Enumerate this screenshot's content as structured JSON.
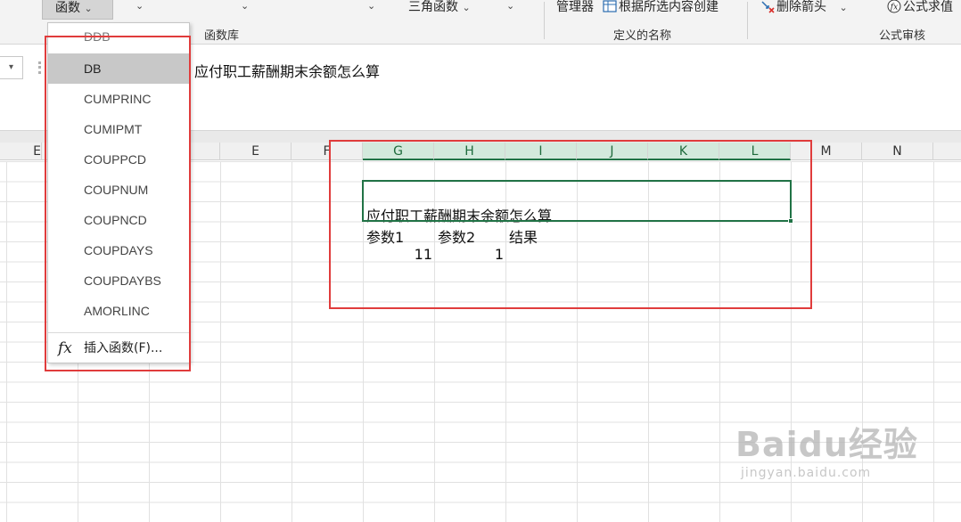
{
  "ribbon": {
    "function_button": "函数",
    "trig_button": "三角函数",
    "name_manager": "管理器",
    "create_from_selection": "根据所选内容创建",
    "remove_arrows": "删除箭头",
    "evaluate_formula": "公式求值",
    "groups": {
      "function_library": "函数库",
      "defined_names": "定义的名称",
      "formula_auditing": "公式审核"
    }
  },
  "formula_bar": {
    "content": "应付职工薪酬期末余额怎么算"
  },
  "columns": [
    "E",
    "F",
    "G",
    "H",
    "I",
    "J",
    "K",
    "L",
    "M",
    "N"
  ],
  "partial_column": "E",
  "selected_columns": [
    "G",
    "H",
    "I",
    "J",
    "K",
    "L"
  ],
  "sheet": {
    "title_cell": "应付职工薪酬期末余额怎么算",
    "headers": [
      "参数1",
      "参数2",
      "结果"
    ],
    "values": [
      "11",
      "1"
    ]
  },
  "menu": {
    "items": [
      "DDB",
      "DB",
      "CUMPRINC",
      "CUMIPMT",
      "COUPPCD",
      "COUPNUM",
      "COUPNCD",
      "COUPDAYS",
      "COUPDAYBS",
      "AMORLINC"
    ],
    "highlighted": "DB",
    "insert_function": "插入函数(F)...",
    "fx_symbol": "fx"
  },
  "watermark": {
    "main": "Baidu经验",
    "sub": "jingyan.baidu.com"
  },
  "colors": {
    "selection_green": "#217346",
    "annotation_red": "#e03c3c",
    "menu_highlight": "#c8c8c8"
  }
}
